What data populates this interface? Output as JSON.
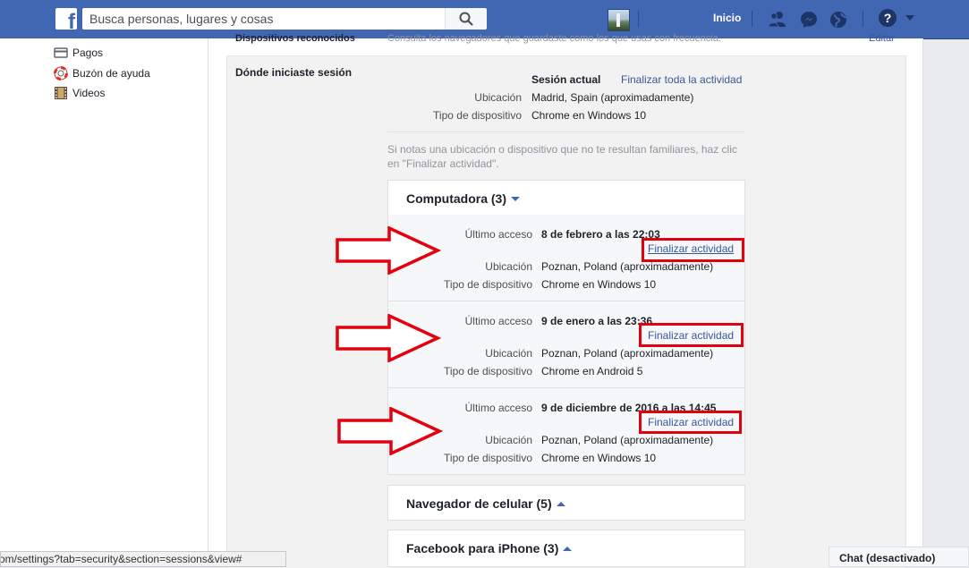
{
  "topbar": {
    "logo": "f",
    "search_placeholder": "Busca personas, lugares y cosas",
    "home_label": "Inicio",
    "icons": [
      "friends-icon",
      "messenger-icon",
      "notifications-globe-icon",
      "help-icon"
    ]
  },
  "sidebar": {
    "items": [
      {
        "label": "Pagos",
        "icon": "payments-card-icon"
      },
      {
        "label": "Buzón de ayuda",
        "icon": "lifebuoy-icon"
      },
      {
        "label": "Videos",
        "icon": "film-icon"
      }
    ]
  },
  "top_row": {
    "title": "Dispositivos reconocidos",
    "description": "Consulta los navegadores que guardaste como los que usas con frecuencia.",
    "edit_label": "Editar"
  },
  "sessions_section": {
    "title": "Dónde iniciaste sesión",
    "current": {
      "label": "Sesión actual",
      "end_all_label": "Finalizar toda la actividad",
      "location_label": "Ubicación",
      "location_value": "Madrid, Spain (aproximadamente)",
      "device_label": "Tipo de dispositivo",
      "device_value": "Chrome en Windows 10"
    },
    "hint": "Si notas una ubicación o dispositivo que no te resultan familiares, haz clic en \"Finalizar actividad\".",
    "groups": [
      {
        "title": "Computadora (3)",
        "expanded": true
      },
      {
        "title": "Navegador de celular (5)",
        "expanded": false
      },
      {
        "title": "Facebook para iPhone (3)",
        "expanded": false
      }
    ],
    "sessions": [
      {
        "last_access_label": "Último acceso",
        "last_access_value": "8 de febrero a las 22:03",
        "end_label": "Finalizar actividad",
        "location_label": "Ubicación",
        "location_value": "Poznan, Poland (aproximadamente)",
        "device_label": "Tipo de dispositivo",
        "device_value": "Chrome en Windows 10"
      },
      {
        "last_access_label": "Último acceso",
        "last_access_value": "9 de enero a las 23:36",
        "end_label": "Finalizar actividad",
        "location_label": "Ubicación",
        "location_value": "Poznan, Poland (aproximadamente)",
        "device_label": "Tipo de dispositivo",
        "device_value": "Chrome en Android 5"
      },
      {
        "last_access_label": "Último acceso",
        "last_access_value": "9 de diciembre de 2016 a las 14:45",
        "end_label": "Finalizar actividad",
        "location_label": "Ubicación",
        "location_value": "Poznan, Poland (aproximadamente)",
        "device_label": "Tipo de dispositivo",
        "device_value": "Chrome en Windows 10"
      }
    ]
  },
  "statusbar": {
    "url": "om/settings?tab=security&section=sessions&view#"
  },
  "chat": {
    "label": "Chat (desactivado)"
  },
  "colors": {
    "brand": "#4267b2",
    "link": "#365899",
    "annotation_red": "#e3000f"
  }
}
